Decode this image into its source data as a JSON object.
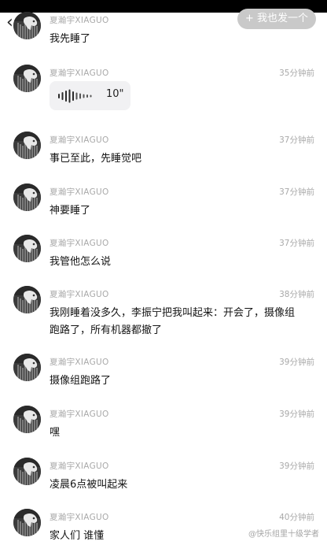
{
  "header": {
    "back_glyph": "‹",
    "post_button": "+ 我也发一个"
  },
  "messages": [
    {
      "name": "夏瀚宇XIAGUO",
      "time": "",
      "text": "我先睡了"
    },
    {
      "name": "夏瀚宇XIAGUO",
      "time": "35分钟前",
      "voice_duration": "10\""
    },
    {
      "name": "夏瀚宇XIAGUO",
      "time": "37分钟前",
      "text": "事已至此，先睡觉吧"
    },
    {
      "name": "夏瀚宇XIAGUO",
      "time": "37分钟前",
      "text": "神要睡了"
    },
    {
      "name": "夏瀚宇XIAGUO",
      "time": "37分钟前",
      "text": "我管他怎么说"
    },
    {
      "name": "夏瀚宇XIAGUO",
      "time": "38分钟前",
      "text": "我刚睡着没多久，李振宁把我叫起来：开会了，摄像组跑路了，所有机器都撤了"
    },
    {
      "name": "夏瀚宇XIAGUO",
      "time": "39分钟前",
      "text": "摄像组跑路了"
    },
    {
      "name": "夏瀚宇XIAGUO",
      "time": "39分钟前",
      "text": "嘿"
    },
    {
      "name": "夏瀚宇XIAGUO",
      "time": "39分钟前",
      "text": "凌晨6点被叫起来"
    },
    {
      "name": "夏瀚宇XIAGUO",
      "time": "40分钟前",
      "text": "家人们 谁懂"
    }
  ],
  "watermark": "@快乐组里十级学者",
  "colors": {
    "background": "#ffffff",
    "meta_text": "#a9a9a9",
    "post_button_bg": "#c9c9c9",
    "voice_bubble_bg": "#f1f1f3"
  }
}
